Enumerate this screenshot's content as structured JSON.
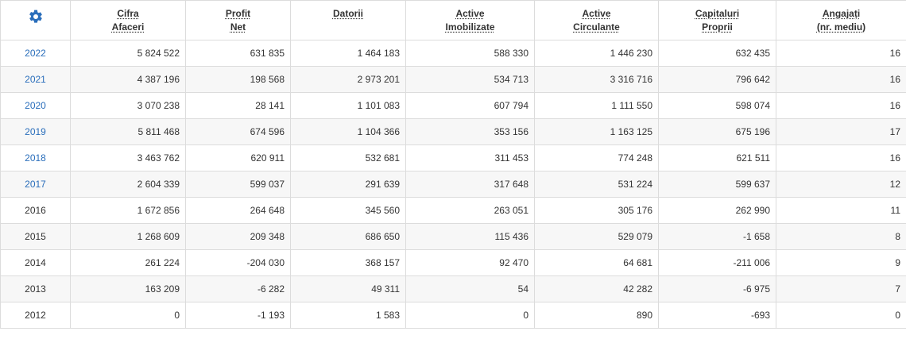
{
  "settings": {
    "icon": "gear-icon",
    "color": "#2a6ebb"
  },
  "columns": [
    {
      "line1": "Cifra",
      "line2": "Afaceri"
    },
    {
      "line1": "Profit",
      "line2": "Net"
    },
    {
      "line1": "Datorii",
      "line2": ""
    },
    {
      "line1": "Active",
      "line2": "Imobilizate"
    },
    {
      "line1": "Active",
      "line2": "Circulante"
    },
    {
      "line1": "Capitaluri",
      "line2": "Proprii"
    },
    {
      "line1": "Angajați",
      "line2": "(nr. mediu)"
    }
  ],
  "rows": [
    {
      "year": "2022",
      "linked": true,
      "values": [
        "5 824 522",
        "631 835",
        "1 464 183",
        "588 330",
        "1 446 230",
        "632 435",
        "16"
      ]
    },
    {
      "year": "2021",
      "linked": true,
      "values": [
        "4 387 196",
        "198 568",
        "2 973 201",
        "534 713",
        "3 316 716",
        "796 642",
        "16"
      ]
    },
    {
      "year": "2020",
      "linked": true,
      "values": [
        "3 070 238",
        "28 141",
        "1 101 083",
        "607 794",
        "1 111 550",
        "598 074",
        "16"
      ]
    },
    {
      "year": "2019",
      "linked": true,
      "values": [
        "5 811 468",
        "674 596",
        "1 104 366",
        "353 156",
        "1 163 125",
        "675 196",
        "17"
      ]
    },
    {
      "year": "2018",
      "linked": true,
      "values": [
        "3 463 762",
        "620 911",
        "532 681",
        "311 453",
        "774 248",
        "621 511",
        "16"
      ]
    },
    {
      "year": "2017",
      "linked": true,
      "values": [
        "2 604 339",
        "599 037",
        "291 639",
        "317 648",
        "531 224",
        "599 637",
        "12"
      ]
    },
    {
      "year": "2016",
      "linked": false,
      "values": [
        "1 672 856",
        "264 648",
        "345 560",
        "263 051",
        "305 176",
        "262 990",
        "11"
      ]
    },
    {
      "year": "2015",
      "linked": false,
      "values": [
        "1 268 609",
        "209 348",
        "686 650",
        "115 436",
        "529 079",
        "-1 658",
        "8"
      ]
    },
    {
      "year": "2014",
      "linked": false,
      "values": [
        "261 224",
        "-204 030",
        "368 157",
        "92 470",
        "64 681",
        "-211 006",
        "9"
      ]
    },
    {
      "year": "2013",
      "linked": false,
      "values": [
        "163 209",
        "-6 282",
        "49 311",
        "54",
        "42 282",
        "-6 975",
        "7"
      ]
    },
    {
      "year": "2012",
      "linked": false,
      "values": [
        "0",
        "-1 193",
        "1 583",
        "0",
        "890",
        "-693",
        "0"
      ]
    }
  ]
}
